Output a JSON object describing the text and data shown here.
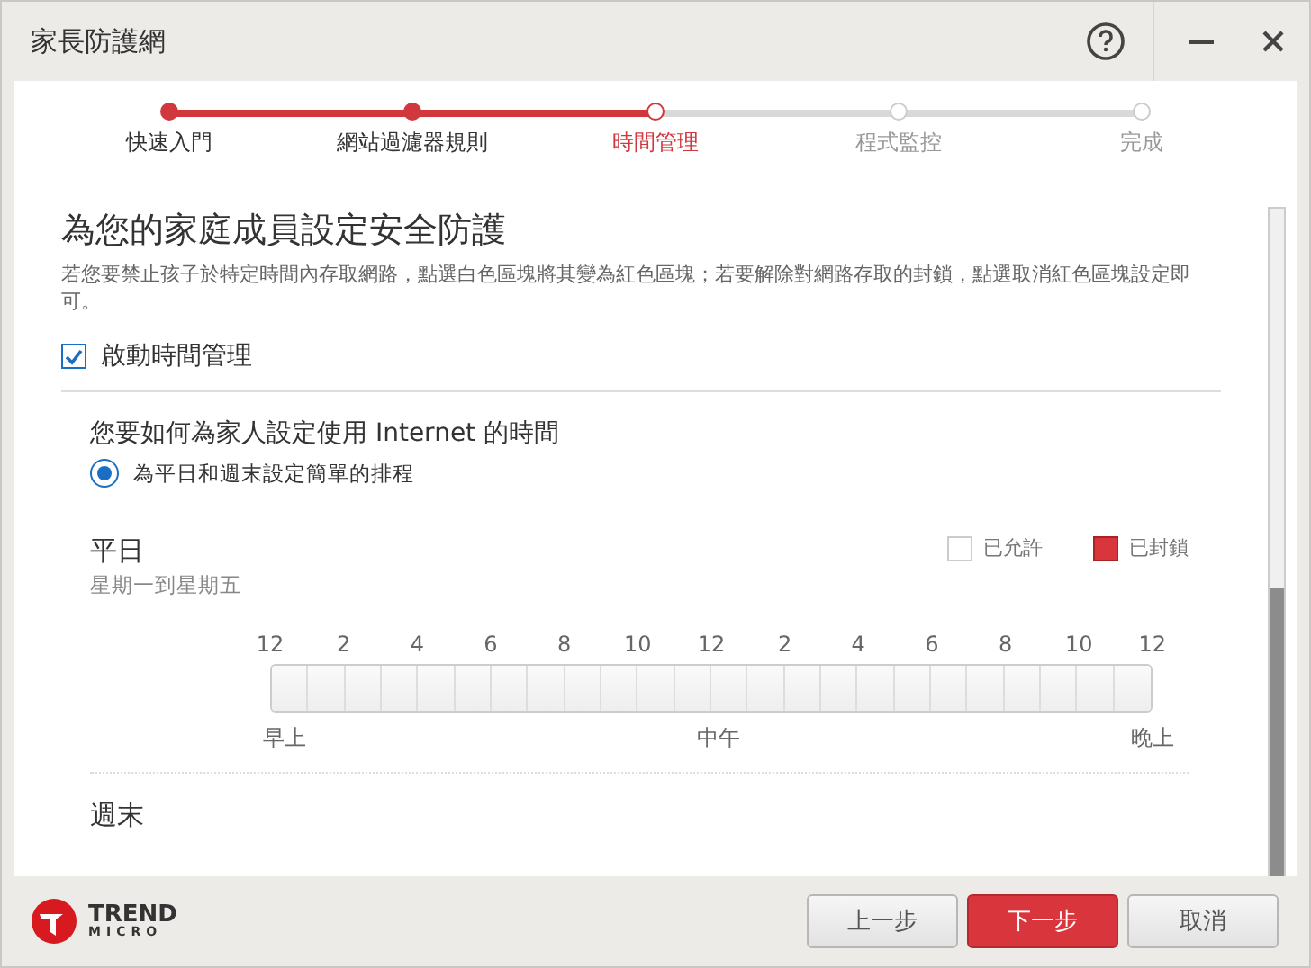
{
  "window": {
    "title": "家長防護網"
  },
  "steps": [
    {
      "label": "快速入門",
      "done": true,
      "selected": false
    },
    {
      "label": "網站過濾器規則",
      "done": true,
      "selected": false
    },
    {
      "label": "時間管理",
      "done": false,
      "selected": true
    },
    {
      "label": "程式監控",
      "done": false,
      "selected": false
    },
    {
      "label": "完成",
      "done": false,
      "selected": false
    }
  ],
  "heading": "為您的家庭成員設定安全防護",
  "description": "若您要禁止孩子於特定時間內存取網路，點選白色區塊將其變為紅色區塊；若要解除對網路存取的封鎖，點選取消紅色區塊設定即可。",
  "enable_checkbox": {
    "label": "啟動時間管理",
    "checked": true
  },
  "question": "您要如何為家人設定使用 Internet 的時間",
  "schedule_options": [
    {
      "label": "為平日和週末設定簡單的排程",
      "selected": true
    }
  ],
  "legend": [
    {
      "label": "已允許",
      "kind": "allowed"
    },
    {
      "label": "已封鎖",
      "kind": "blocked"
    }
  ],
  "weekday": {
    "title": "平日",
    "subtitle": "星期一到星期五",
    "hour_labels": [
      "12",
      "2",
      "4",
      "6",
      "8",
      "10",
      "12",
      "2",
      "4",
      "6",
      "8",
      "10",
      "12"
    ],
    "period_labels": [
      "早上",
      "中午",
      "晚上"
    ],
    "slots": [
      {
        "blocked": false
      },
      {
        "blocked": false
      },
      {
        "blocked": false
      },
      {
        "blocked": false
      },
      {
        "blocked": false
      },
      {
        "blocked": false
      },
      {
        "blocked": false
      },
      {
        "blocked": false
      },
      {
        "blocked": false
      },
      {
        "blocked": false
      },
      {
        "blocked": false
      },
      {
        "blocked": false
      },
      {
        "blocked": false
      },
      {
        "blocked": false
      },
      {
        "blocked": false
      },
      {
        "blocked": false
      },
      {
        "blocked": false
      },
      {
        "blocked": false
      },
      {
        "blocked": false
      },
      {
        "blocked": false
      },
      {
        "blocked": false
      },
      {
        "blocked": false
      },
      {
        "blocked": false
      },
      {
        "blocked": false
      }
    ]
  },
  "weekend": {
    "title": "週末"
  },
  "logo": {
    "line_1": "TREND",
    "line_2": "MICRO"
  },
  "buttons": [
    {
      "label": "上一步",
      "kind": "secondary"
    },
    {
      "label": "下一步",
      "kind": "primary"
    },
    {
      "label": "取消",
      "kind": "secondary"
    }
  ]
}
